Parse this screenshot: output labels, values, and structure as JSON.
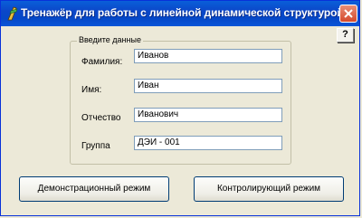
{
  "window": {
    "title": "Тренажёр для работы с линейной динамической структурой",
    "help_label": "?"
  },
  "group": {
    "legend": "Введите данные",
    "fields": [
      {
        "label": "Фамилия:",
        "value": "Иванов"
      },
      {
        "label": "Имя:",
        "value": "Иван"
      },
      {
        "label": "Отчество",
        "value": "Иванович"
      },
      {
        "label": "Группа",
        "value": "ДЭИ - 001"
      }
    ]
  },
  "buttons": {
    "demo": "Демонстрационный режим",
    "control": "Контролирующий режим"
  },
  "colors": {
    "titlebar": "#0b47c9",
    "close": "#d5492b",
    "background": "#ece9d8"
  },
  "icons": {
    "app": "app-icon",
    "close": "close-icon"
  }
}
